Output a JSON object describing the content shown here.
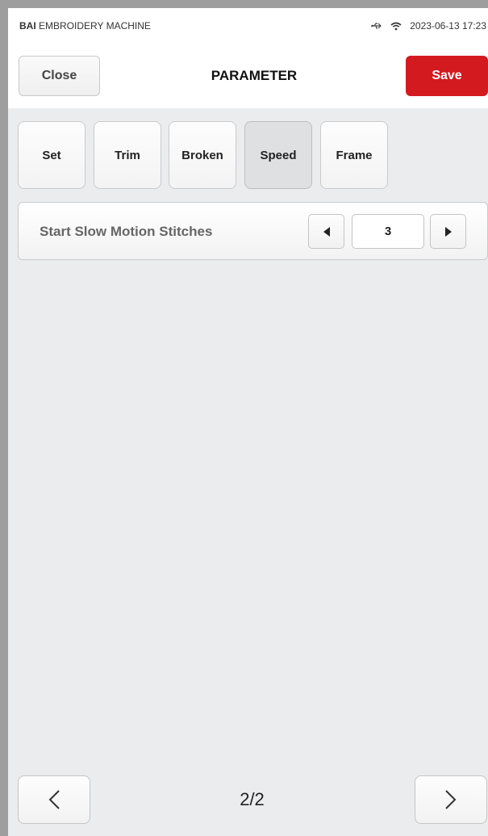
{
  "status_bar": {
    "brand_bold": "BAI",
    "brand_rest": " EMBROIDERY MACHINE",
    "datetime": "2023-06-13 17:23",
    "icons": [
      "usb-icon",
      "wifi-icon"
    ]
  },
  "header": {
    "close_label": "Close",
    "title": "PARAMETER",
    "save_label": "Save"
  },
  "tabs": [
    {
      "label": "Set",
      "active": false
    },
    {
      "label": "Trim",
      "active": false
    },
    {
      "label": "Broken",
      "active": false
    },
    {
      "label": "Speed",
      "active": true
    },
    {
      "label": "Frame",
      "active": false
    }
  ],
  "parameters": [
    {
      "label": "Start Slow Motion Stitches",
      "value": "3"
    }
  ],
  "pager": {
    "indicator": "2/2",
    "prev_icon": "chevron-left-icon",
    "next_icon": "chevron-right-icon"
  },
  "colors": {
    "accent_save": "#d31a1f",
    "background": "#ebecee"
  }
}
